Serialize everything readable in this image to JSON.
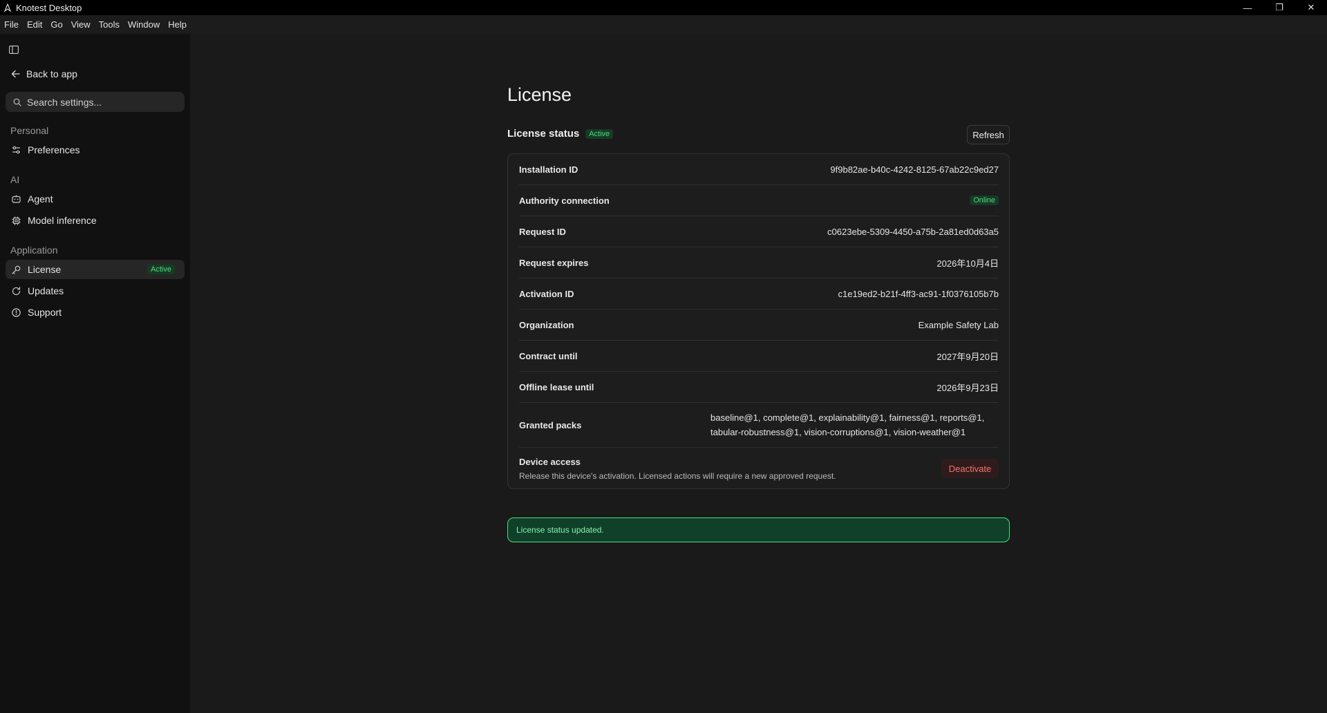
{
  "window": {
    "title": "Knotest Desktop",
    "controls": {
      "minimize": "—",
      "restore": "❐",
      "close": "✕"
    }
  },
  "menu": [
    "File",
    "Edit",
    "Go",
    "View",
    "Tools",
    "Window",
    "Help"
  ],
  "sidebar": {
    "back_label": "Back to app",
    "search_placeholder": "Search settings...",
    "sections": {
      "personal": "Personal",
      "ai": "AI",
      "application": "Application"
    },
    "items": {
      "preferences": "Preferences",
      "agent": "Agent",
      "model_inference": "Model inference",
      "license": "License",
      "license_badge": "Active",
      "updates": "Updates",
      "support": "Support"
    }
  },
  "main": {
    "title": "License",
    "status_title": "License status",
    "status_badge": "Active",
    "refresh_label": "Refresh",
    "rows": {
      "installation_id": {
        "label": "Installation ID",
        "value": "9f9b82ae-b40c-4242-8125-67ab22c9ed27"
      },
      "authority": {
        "label": "Authority connection",
        "value": "Online"
      },
      "request_id": {
        "label": "Request ID",
        "value": "c0623ebe-5309-4450-a75b-2a81ed0d63a5"
      },
      "request_expires": {
        "label": "Request expires",
        "value": "2026年10月4日"
      },
      "activation_id": {
        "label": "Activation ID",
        "value": "c1e19ed2-b21f-4ff3-ac91-1f0376105b7b"
      },
      "organization": {
        "label": "Organization",
        "value": "Example Safety Lab"
      },
      "contract_until": {
        "label": "Contract until",
        "value": "2027年9月20日"
      },
      "offline_lease": {
        "label": "Offline lease until",
        "value": "2026年9月23日"
      },
      "granted_packs": {
        "label": "Granted packs",
        "value": "baseline@1, complete@1, explainability@1, fairness@1, reports@1, tabular-robustness@1, vision-corruptions@1, vision-weather@1"
      }
    },
    "device": {
      "label": "Device access",
      "description": "Release this device's activation. Licensed actions will require a new approved request.",
      "deactivate_label": "Deactivate"
    },
    "toast": "License status updated."
  },
  "colors": {
    "accent_green": "#4ade80",
    "danger_red": "#f87171",
    "sidebar_bg": "#111111",
    "main_bg": "#1a1a1a"
  }
}
